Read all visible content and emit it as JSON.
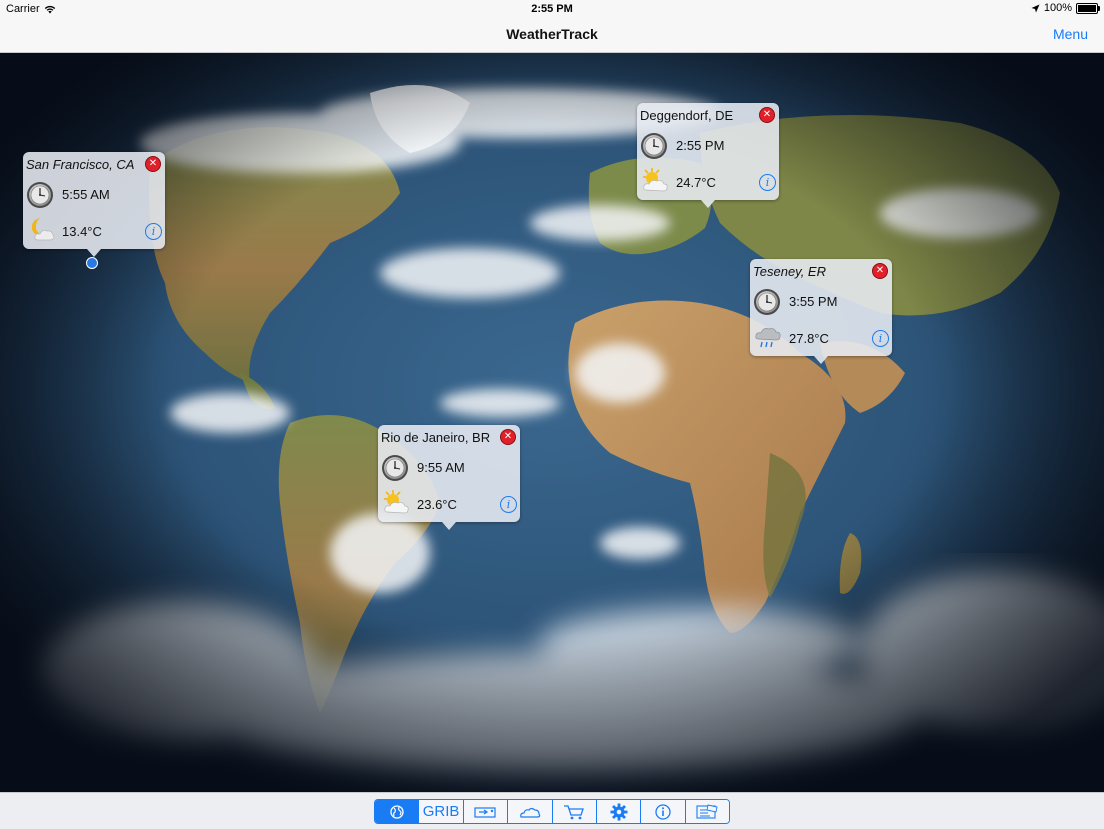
{
  "status_bar": {
    "carrier": "Carrier",
    "time": "2:55 PM",
    "battery": "100%",
    "battery_level": 1.0
  },
  "nav": {
    "title": "WeatherTrack",
    "menu_label": "Menu"
  },
  "colors": {
    "accent": "#1a7cf5",
    "remove": "#e0202a"
  },
  "locations": [
    {
      "name": "San Francisco, CA",
      "italic": true,
      "time": "5:55 AM",
      "temp": "13.4°C",
      "weather_icon": "partly-cloudy-night-icon"
    },
    {
      "name": "Deggendorf, DE",
      "italic": false,
      "time": "2:55 PM",
      "temp": "24.7°C",
      "weather_icon": "partly-sunny-icon"
    },
    {
      "name": "Teseney, ER",
      "italic": true,
      "time": "3:55 PM",
      "temp": "27.8°C",
      "weather_icon": "rain-cloud-icon"
    },
    {
      "name": "Rio de Janeiro, BR",
      "italic": false,
      "time": "9:55 AM",
      "temp": "23.6°C",
      "weather_icon": "partly-sunny-icon"
    }
  ],
  "toolbar": {
    "tabs": [
      {
        "icon": "globe-icon",
        "active": true
      },
      {
        "label": "GRIB",
        "icon": "grib-icon",
        "active": false
      },
      {
        "icon": "wind-map-icon",
        "active": false
      },
      {
        "icon": "cloud-icon",
        "active": false
      },
      {
        "icon": "cart-icon",
        "active": false
      },
      {
        "icon": "gear-icon",
        "active": false
      },
      {
        "icon": "info-icon",
        "active": false
      },
      {
        "icon": "news-icon",
        "active": false
      }
    ]
  }
}
